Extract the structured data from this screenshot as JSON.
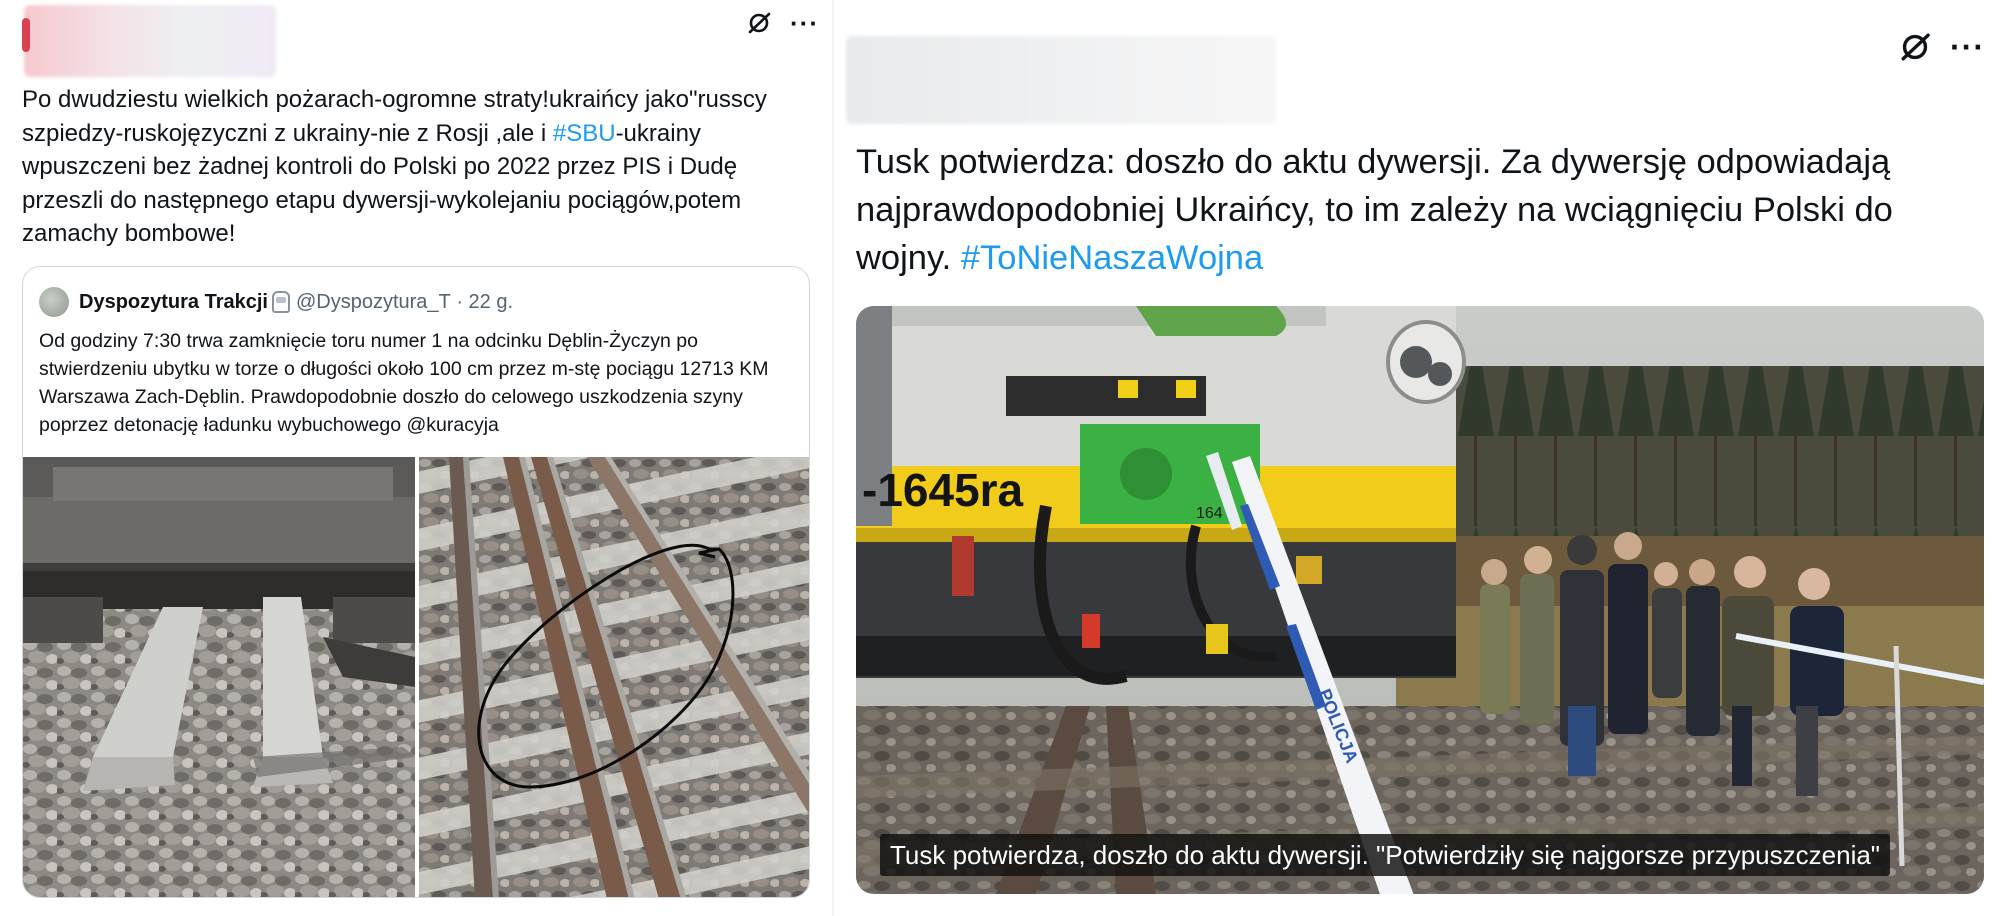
{
  "left_post": {
    "author_label": "",
    "text_parts": [
      "Po dwudziestu wielkich pożarach-ogromne straty!ukraińcy jako\"russcy szpiedzy-ruskojęzyczni z ukrainy-nie z Rosji ,ale i ",
      "#SBU",
      "-ukrainy wpuszczeni bez żadnej kontroli do Polski po 2022 przez PIS i Dudę przeszli do następnego etapu dywersji-wykolejaniu pociągów,potem zamachy bombowe!"
    ],
    "quote": {
      "name": "Dyspozytura Trakcji",
      "handle": "@Dyspozytura_T",
      "separator": " · ",
      "time": "22 g.",
      "text": "Od godziny 7:30 trwa zamknięcie toru numer 1 na odcinku Dęblin-Życzyn po stwierdzeniu ubytku w torze o długości około 100 cm przez m-stę pociągu 12713 KM Warszawa Zach-Dęblin. Prawdopodobnie doszło do celowego uszkodzenia szyny poprzez detonację ładunku wybuchowego @kuracyja",
      "images": [
        "damaged-sleepers-photo",
        "marked-rail-gap-photo"
      ]
    },
    "icons": {
      "grok": "grok-icon",
      "more": "more-icon"
    }
  },
  "right_post": {
    "author_label": "",
    "text_parts": [
      "Tusk potwierdza: doszło do aktu dywersji. Za dywersję odpowiadają najprawdopodobniej Ukraińcy, to im zależy na wciągnięciu Polski do wojny. ",
      "#ToNieNaszaWojna"
    ],
    "photo": {
      "caption": "Tusk potwierdza, doszło do aktu dywersji. \"Potwierdziły się najgorsze przypuszczenia\"",
      "train_number": "-1645ra",
      "tape_text": "POLICJA",
      "unit_number": "164"
    },
    "icons": {
      "grok": "grok-icon",
      "more": "more-icon"
    }
  },
  "colors": {
    "link": "#1d9bf0",
    "text": "#0f1419",
    "muted": "#536471",
    "border": "#cfd9de"
  }
}
